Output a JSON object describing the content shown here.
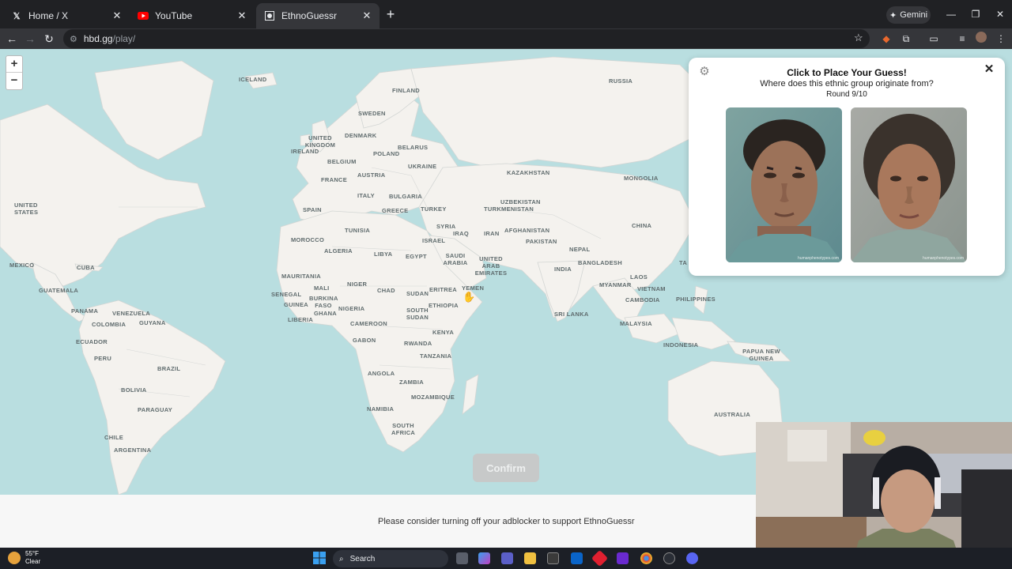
{
  "browser": {
    "tabs": [
      {
        "label": "Home / X",
        "icon": "x-logo-icon"
      },
      {
        "label": "YouTube",
        "icon": "youtube-icon"
      },
      {
        "label": "EthnoGuessr",
        "icon": "ethnoguessr-icon",
        "active": true
      }
    ],
    "gemini_label": "Gemini",
    "url_host": "hbd.gg",
    "url_path": "/play/"
  },
  "map": {
    "labels": [
      "ICELAND",
      "RUSSIA",
      "FINLAND",
      "SWEDEN",
      "UNITED KINGDOM",
      "IRELAND",
      "DENMARK",
      "BELARUS",
      "POLAND",
      "BELGIUM",
      "UKRAINE",
      "KAZAKHSTAN",
      "MONGOLIA",
      "AUSTRIA",
      "FRANCE",
      "ITALY",
      "BULGARIA",
      "UZBEKISTAN",
      "UNITED STATES",
      "SPAIN",
      "GREECE",
      "TURKEY",
      "TURKMENISTAN",
      "CHINA",
      "SYRIA",
      "IRAQ",
      "IRAN",
      "AFGHANISTAN",
      "TUNISIA",
      "MOROCCO",
      "ISRAEL",
      "PAKISTAN",
      "ALGERIA",
      "LIBYA",
      "EGYPT",
      "SAUDI ARABIA",
      "NEPAL",
      "UNITED ARAB EMIRATES",
      "TA",
      "MEXICO",
      "CUBA",
      "INDIA",
      "BANGLADESH",
      "MAURITANIA",
      "MYANMAR",
      "LAOS",
      "GUATEMALA",
      "MALI",
      "NIGER",
      "CHAD",
      "SUDAN",
      "ERITREA",
      "YEMEN",
      "VIETNAM",
      "SENEGAL",
      "BURKINA FASO",
      "CAMBODIA",
      "PHILIPPINES",
      "GUINEA",
      "NIGERIA",
      "ETHIOPIA",
      "PANAMA",
      "VENEZUELA",
      "LIBERIA",
      "GHANA",
      "SOUTH SUDAN",
      "SRI LANKA",
      "COLOMBIA",
      "GUYANA",
      "CAMEROON",
      "MALAYSIA",
      "KENYA",
      "ECUADOR",
      "GABON",
      "RWANDA",
      "INDONESIA",
      "PAPUA NEW GUINEA",
      "PERU",
      "BRAZIL",
      "TANZANIA",
      "ANGOLA",
      "ZAMBIA",
      "BOLIVIA",
      "MOZAMBIQUE",
      "NAMIBIA",
      "PARAGUAY",
      "AUSTRALIA",
      "SOUTH AFRICA",
      "CHILE",
      "ARGENTINA"
    ],
    "zoom_in": "+",
    "zoom_out": "−",
    "confirm_label": "Confirm"
  },
  "card": {
    "title": "Click to Place Your Guess!",
    "question": "Where does this ethnic group originate from?",
    "round": "Round 9/10",
    "watermark_male": "humanphenotypes.com",
    "watermark_female": "humanphenotypes.com"
  },
  "footer_note": "Please consider turning off your adblocker to support EthnoGuessr",
  "taskbar": {
    "temp": "55°F",
    "condition": "Clear",
    "search_label": "Search"
  }
}
